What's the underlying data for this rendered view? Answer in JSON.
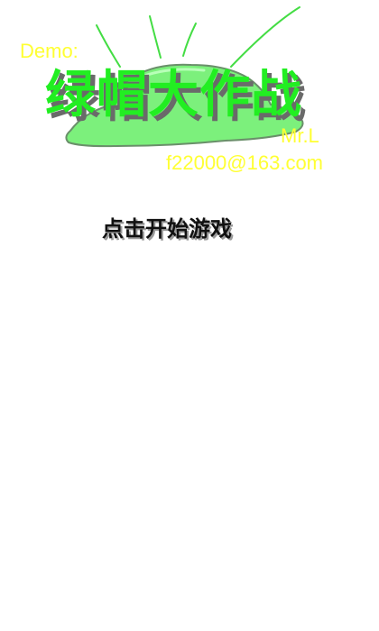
{
  "header": {
    "demo_label": "Demo:",
    "title": "绿帽大作战",
    "author": "Mr.L",
    "email": "f22000@163.com"
  },
  "menu": {
    "start_label": "点击开始游戏"
  },
  "colors": {
    "hat_fill": "#7cf07c",
    "hat_outline": "#6a8f6a",
    "rays": "#44dd44",
    "title": "#22ee22",
    "yellow_text": "#ffff33"
  },
  "art": {
    "icon": "green-hat-icon"
  }
}
